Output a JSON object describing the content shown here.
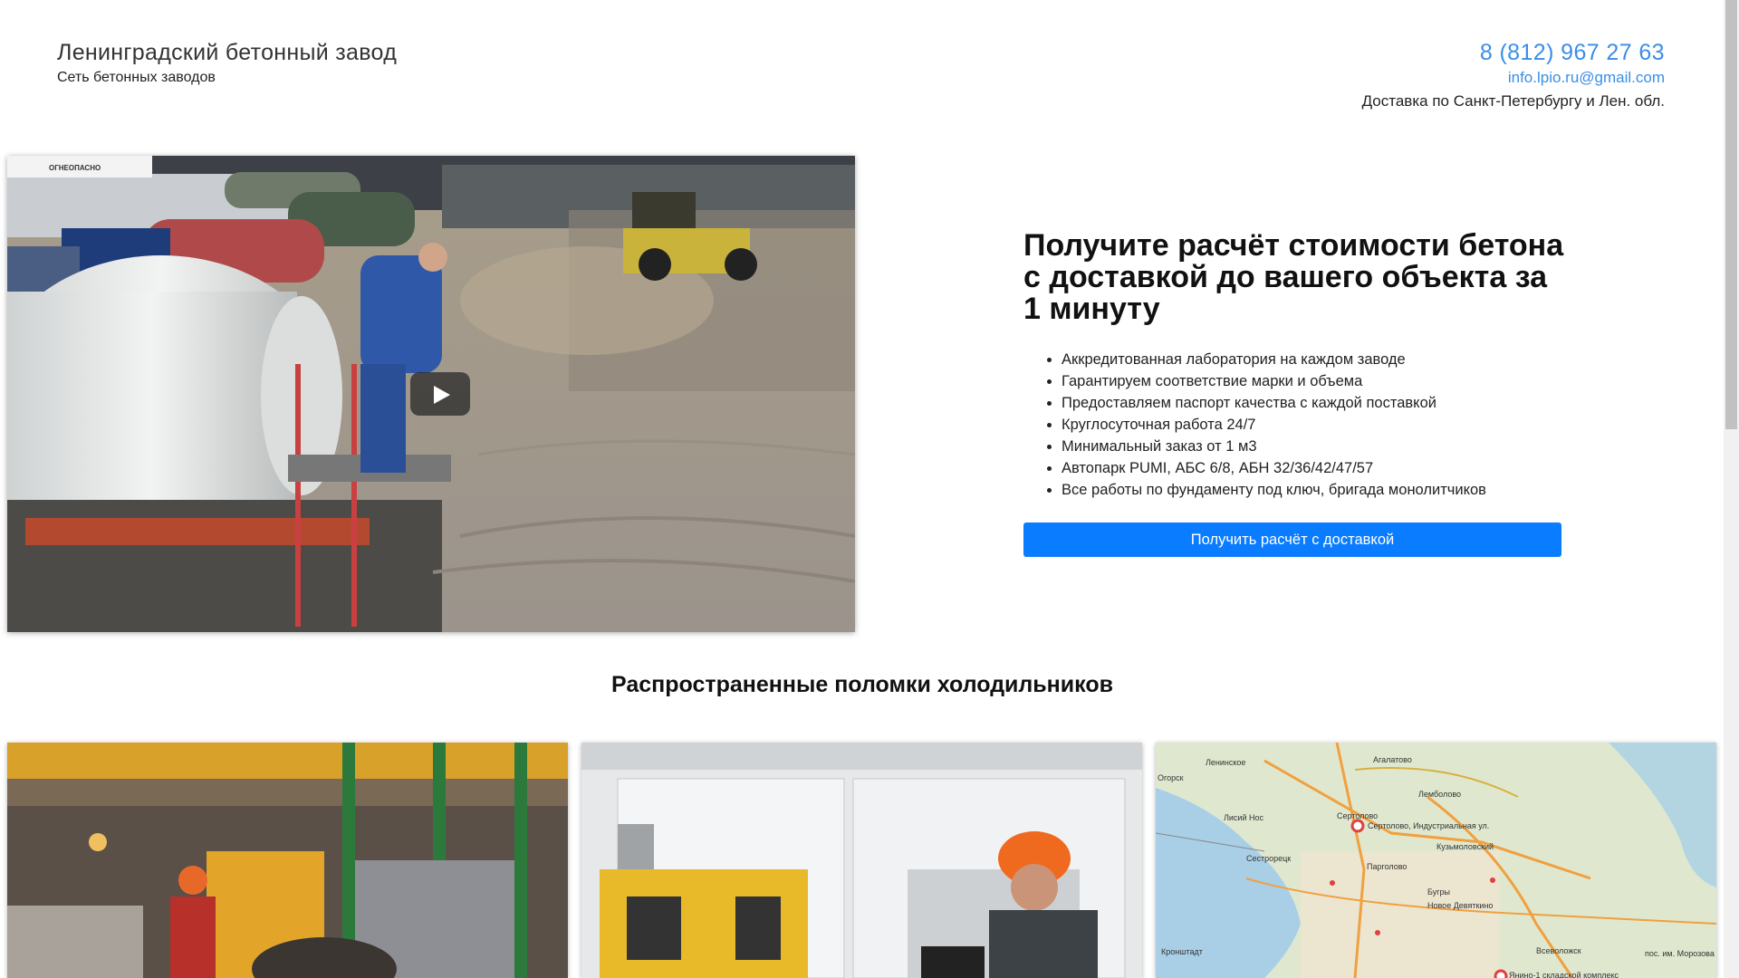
{
  "header": {
    "company_name": "Ленинградский бетонный завод",
    "tagline": "Сеть бетонных заводов",
    "phone": "8 (812) 967 27 63",
    "email": "info.lpio.ru@gmail.com",
    "delivery": "Доставка по Санкт-Петербургу и Лен. обл."
  },
  "video": {
    "icon": "play-icon",
    "truck_text": "ОГНЕОПАСНО"
  },
  "offer": {
    "title": "Получите расчёт стоимости бетона с доставкой до вашего объекта за 1 минуту",
    "features": [
      "Аккредитованная лаборатория на каждом заводе",
      "Гарантируем соответствие марки и объема",
      "Предоставляем паспорт качества с каждой поставкой",
      "Круглосуточная работа 24/7",
      "Минимальный заказ от 1 м3",
      "Автопарк PUMI, АБС 6/8, АБН 32/36/42/47/57",
      "Все работы по фундаменту под ключ, бригада монолитчиков"
    ],
    "cta_label": "Получить расчёт с доставкой",
    "cta_color": "#0a7cff"
  },
  "section": {
    "title": "Распространенные поломки холодильников"
  },
  "map": {
    "labels": [
      "Агалатово",
      "Лемболово",
      "Огорск",
      "Ленинское",
      "Лисий Нос",
      "Сертолово",
      "Сертолово, Индустриальная ул.",
      "Кузьмоловский",
      "Сестрорецк",
      "Парголово",
      "Бугры",
      "Новое Девяткино",
      "Всеволожск",
      "Кронштадт",
      "Янино-1 складской комплекс",
      "пос. им. Морозова"
    ]
  },
  "colors": {
    "link": "#3b8ee6",
    "accent": "#0a7cff"
  }
}
